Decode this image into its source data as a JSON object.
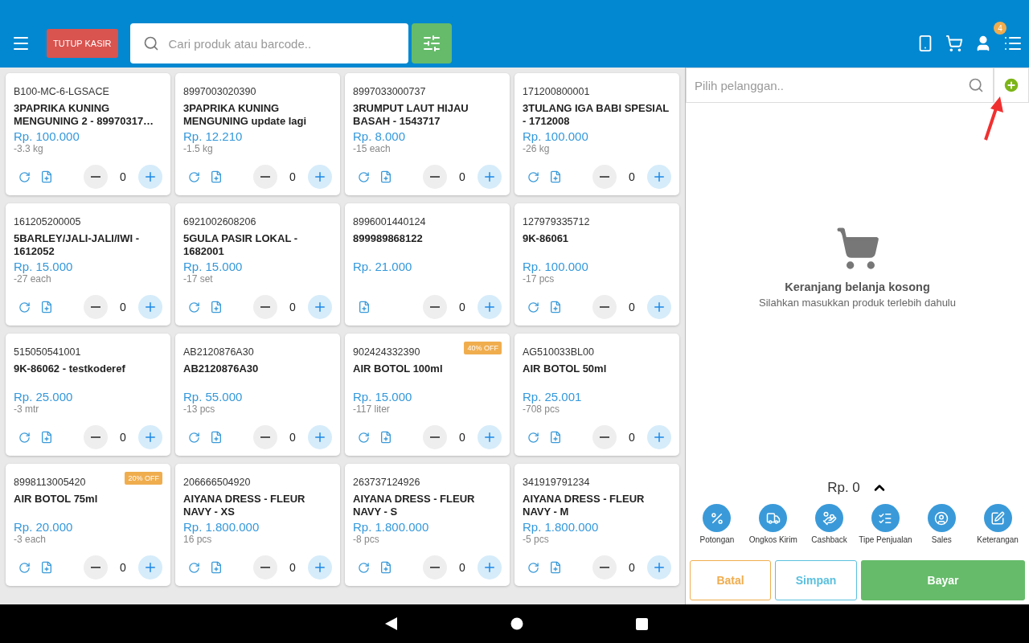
{
  "topbar": {
    "close_register": "TUTUP KASIR",
    "search": {
      "placeholder": "Cari produk atau barcode.."
    },
    "notification_count": "4"
  },
  "products": [
    {
      "code": "B100-MC-6-LGSACE",
      "name": "3PAPRIKA KUNING MENGUNING 2 - 89970317…",
      "price": "Rp. 100.000",
      "stock": "-3.3 kg",
      "refreshable": true,
      "qty": "0"
    },
    {
      "code": "8997003020390",
      "name": "3PAPRIKA KUNING MENGUNING update lagi",
      "price": "Rp. 12.210",
      "stock": "-1.5 kg",
      "refreshable": true,
      "qty": "0"
    },
    {
      "code": "8997033000737",
      "name": "3RUMPUT LAUT HIJAU BASAH - 1543717",
      "price": "Rp. 8.000",
      "stock": "-15 each",
      "refreshable": true,
      "qty": "0"
    },
    {
      "code": "171200800001",
      "name": "3TULANG IGA BABI SPESIAL - 1712008",
      "price": "Rp. 100.000",
      "stock": "-26 kg",
      "refreshable": true,
      "qty": "0"
    },
    {
      "code": "161205200005",
      "name": "5BARLEY/JALI-JALI/IWI - 1612052",
      "price": "Rp. 15.000",
      "stock": "-27 each",
      "refreshable": true,
      "qty": "0"
    },
    {
      "code": "6921002608206",
      "name": "5GULA PASIR LOKAL - 1682001",
      "price": "Rp. 15.000",
      "stock": "-17 set",
      "refreshable": true,
      "qty": "0"
    },
    {
      "code": "8996001440124",
      "name": "899989868122",
      "price": "Rp. 21.000",
      "refreshable": false,
      "qty": "0"
    },
    {
      "code": "127979335712",
      "name": "9K-86061",
      "price": "Rp. 100.000",
      "stock": "-17 pcs",
      "refreshable": true,
      "qty": "0"
    },
    {
      "code": "515050541001",
      "name": "9K-86062 - testkoderef",
      "price": "Rp. 25.000",
      "stock": "-3 mtr",
      "refreshable": true,
      "qty": "0"
    },
    {
      "code": "AB2120876A30",
      "name": "AB2120876A30",
      "price": "Rp. 55.000",
      "stock": "-13 pcs",
      "refreshable": true,
      "qty": "0"
    },
    {
      "code": "902424332390",
      "discount": "40% OFF",
      "name": "AIR BOTOL 100ml",
      "price": "Rp. 15.000",
      "stock": "-117 liter",
      "refreshable": true,
      "qty": "0"
    },
    {
      "code": "AG510033BL00",
      "name": "AIR BOTOL 50ml",
      "price": "Rp. 25.001",
      "stock": "-708 pcs",
      "refreshable": true,
      "qty": "0"
    },
    {
      "code": "8998113005420",
      "discount": "20% OFF",
      "name": "AIR BOTOL 75ml",
      "price": "Rp. 20.000",
      "stock": "-3 each",
      "refreshable": true,
      "qty": "0"
    },
    {
      "code": "206666504920",
      "name": "AIYANA DRESS - FLEUR NAVY - XS",
      "price": "Rp. 1.800.000",
      "stock": "16 pcs",
      "refreshable": true,
      "qty": "0"
    },
    {
      "code": "263737124926",
      "name": "AIYANA DRESS - FLEUR NAVY - S",
      "price": "Rp. 1.800.000",
      "stock": "-8 pcs",
      "refreshable": true,
      "qty": "0"
    },
    {
      "code": "341919791234",
      "name": "AIYANA DRESS - FLEUR NAVY - M",
      "price": "Rp. 1.800.000",
      "stock": "-5 pcs",
      "refreshable": true,
      "qty": "0"
    }
  ],
  "cart": {
    "customer_search": {
      "placeholder": "Pilih pelanggan.."
    },
    "empty_title": "Keranjang belanja kosong",
    "empty_text": "Silahkan masukkan produk terlebih dahulu",
    "total": "Rp. 0",
    "actions": [
      {
        "kind": "discount",
        "label": "Potongan"
      },
      {
        "kind": "shipping",
        "label": "Ongkos Kirim"
      },
      {
        "kind": "cashback",
        "label": "Cashback"
      },
      {
        "kind": "type",
        "label": "Tipe Penjualan"
      },
      {
        "kind": "sales",
        "label": "Sales"
      },
      {
        "kind": "note",
        "label": "Keterangan"
      }
    ],
    "buttons": [
      {
        "kind": "cancel",
        "label": "Batal"
      },
      {
        "kind": "save",
        "label": "Simpan"
      },
      {
        "kind": "pay",
        "label": "Bayar"
      }
    ]
  }
}
